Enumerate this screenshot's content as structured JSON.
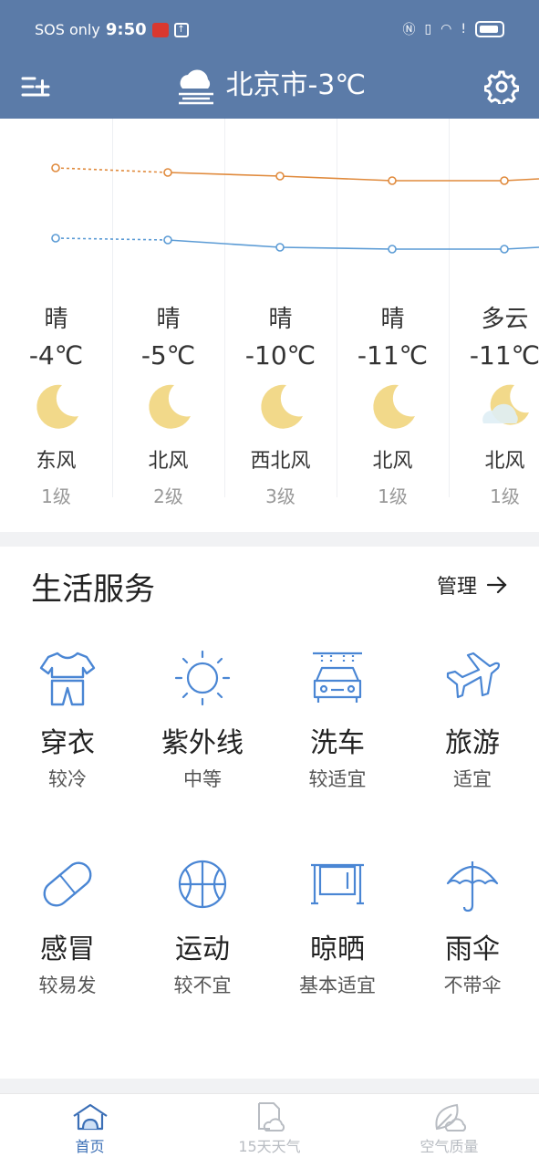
{
  "status_bar": {
    "carrier": "SOS only",
    "time": "9:50"
  },
  "header": {
    "title": "北京市-3℃"
  },
  "forecast": {
    "columns": [
      {
        "cond": "晴",
        "temp": "-4℃",
        "wind": "东风",
        "level": "1级",
        "icon": "moon-icon"
      },
      {
        "cond": "晴",
        "temp": "-5℃",
        "wind": "北风",
        "level": "2级",
        "icon": "moon-icon"
      },
      {
        "cond": "晴",
        "temp": "-10℃",
        "wind": "西北风",
        "level": "3级",
        "icon": "moon-icon"
      },
      {
        "cond": "晴",
        "temp": "-11℃",
        "wind": "北风",
        "level": "1级",
        "icon": "moon-icon"
      },
      {
        "cond": "多云",
        "temp": "-11℃",
        "wind": "北风",
        "level": "1级",
        "icon": "cloudy-moon-icon"
      }
    ],
    "line_colors": {
      "high": "#e08a3c",
      "low": "#5b9bd5"
    }
  },
  "life": {
    "title": "生活服务",
    "manage_label": "管理",
    "items": [
      {
        "name": "穿衣",
        "value": "较冷",
        "icon": "clothing-icon"
      },
      {
        "name": "紫外线",
        "value": "中等",
        "icon": "uv-icon"
      },
      {
        "name": "洗车",
        "value": "较适宜",
        "icon": "car-wash-icon"
      },
      {
        "name": "旅游",
        "value": "适宜",
        "icon": "plane-icon"
      },
      {
        "name": "感冒",
        "value": "较易发",
        "icon": "pill-icon"
      },
      {
        "name": "运动",
        "value": "较不宜",
        "icon": "basketball-icon"
      },
      {
        "name": "晾晒",
        "value": "基本适宜",
        "icon": "drying-rack-icon"
      },
      {
        "name": "雨伞",
        "value": "不带伞",
        "icon": "umbrella-icon"
      }
    ]
  },
  "nav": {
    "items": [
      {
        "label": "首页",
        "icon": "home-icon",
        "active": true
      },
      {
        "label": "15天天气",
        "icon": "calendar-cloud-icon",
        "active": false
      },
      {
        "label": "空气质量",
        "icon": "leaf-icon",
        "active": false
      }
    ]
  },
  "colors": {
    "accent": "#5b7ba8",
    "icon_blue": "#4a86d4",
    "active_nav": "#3b6fb6",
    "inactive_nav": "#b8bcc2"
  }
}
